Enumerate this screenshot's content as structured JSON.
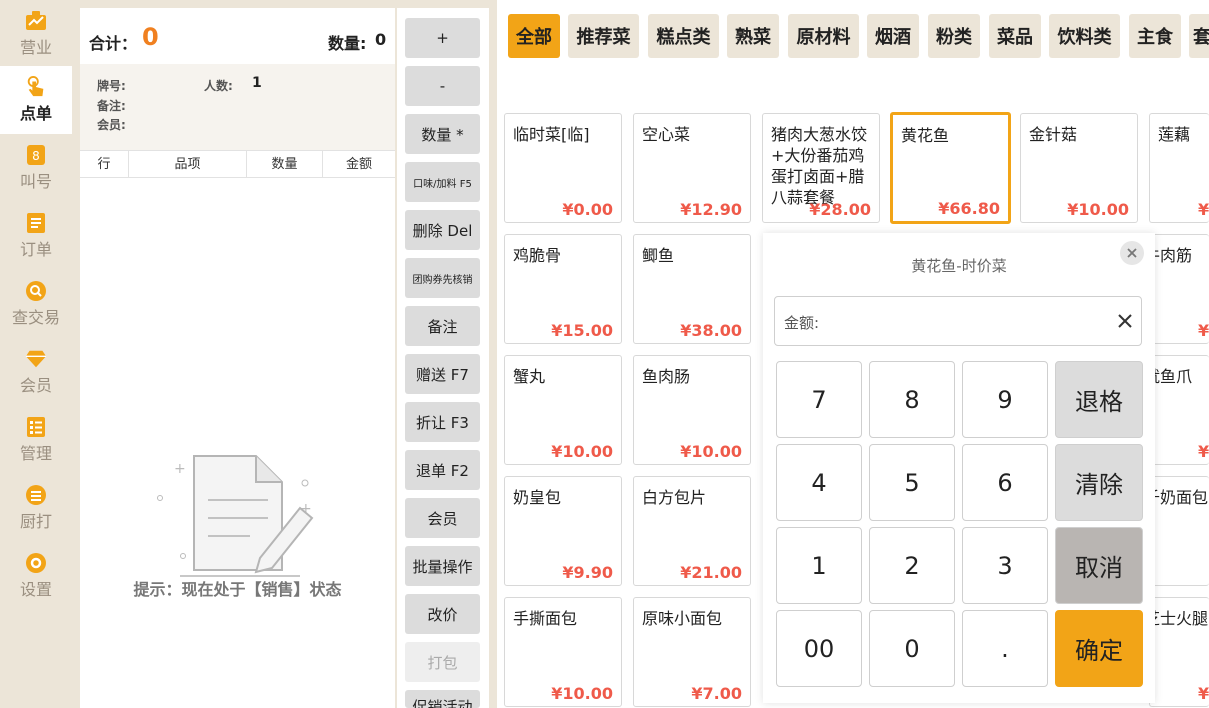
{
  "nav": {
    "items": [
      {
        "label": "营业",
        "icon": "chart-icon"
      },
      {
        "label": "点单",
        "icon": "tap-hand-icon"
      },
      {
        "label": "叫号",
        "icon": "number-icon"
      },
      {
        "label": "订单",
        "icon": "list-icon"
      },
      {
        "label": "查交易",
        "icon": "search-icon"
      },
      {
        "label": "会员",
        "icon": "diamond-icon"
      },
      {
        "label": "管理",
        "icon": "checklist-icon"
      },
      {
        "label": "厨打",
        "icon": "menu-icon"
      },
      {
        "label": "设置",
        "icon": "gear-icon"
      }
    ],
    "active_index": 1
  },
  "order": {
    "total_label": "合计：",
    "total_value": "0",
    "qty_label": "数量:",
    "qty_value": "0",
    "tag_label": "牌号:",
    "people_label": "人数:",
    "people_value": "1",
    "note_label": "备注:",
    "member_label": "会员:",
    "columns": [
      "行",
      "品项",
      "数量",
      "金额"
    ],
    "empty_tip": "提示：现在处于【销售】状态"
  },
  "actions": [
    {
      "label": "+",
      "size": "normal"
    },
    {
      "label": "-",
      "size": "normal"
    },
    {
      "label": "数量 *",
      "size": "normal"
    },
    {
      "label": "口味/加料 F5",
      "size": "small"
    },
    {
      "label": "删除 Del",
      "size": "normal"
    },
    {
      "label": "团购券先核销",
      "size": "small"
    },
    {
      "label": "备注",
      "size": "normal"
    },
    {
      "label": "赠送 F7",
      "size": "normal"
    },
    {
      "label": "折让 F3",
      "size": "normal"
    },
    {
      "label": "退单 F2",
      "size": "normal"
    },
    {
      "label": "会员",
      "size": "normal"
    },
    {
      "label": "批量操作",
      "size": "normal"
    },
    {
      "label": "改价",
      "size": "normal"
    },
    {
      "label": "打包",
      "size": "disabled"
    },
    {
      "label": "促销活动",
      "size": "normal"
    }
  ],
  "categories": [
    "全部",
    "推荐菜",
    "糕点类",
    "熟菜",
    "原材料",
    "烟酒",
    "粉类",
    "菜品",
    "饮料类",
    "主食",
    "套"
  ],
  "active_category": 0,
  "dishes": [
    {
      "name": "临时菜[临]",
      "price": "¥0.00"
    },
    {
      "name": "空心菜",
      "price": "¥12.90"
    },
    {
      "name": "猪肉大葱水饺+大份番茄鸡蛋打卤面+腊八蒜套餐",
      "price": "¥28.00"
    },
    {
      "name": "黄花鱼",
      "price": "¥66.80"
    },
    {
      "name": "金针菇",
      "price": "¥10.00"
    },
    {
      "name": "莲藕",
      "price": "¥"
    },
    {
      "name": "鸡脆骨",
      "price": "¥15.00"
    },
    {
      "name": "鲫鱼",
      "price": "¥38.00"
    },
    {
      "name": "牛肉筋",
      "price": "¥"
    },
    {
      "name": "蟹丸",
      "price": "¥10.00"
    },
    {
      "name": "鱼肉肠",
      "price": "¥10.00"
    },
    {
      "name": "鱿鱼爪",
      "price": "¥"
    },
    {
      "name": "奶皇包",
      "price": "¥9.90"
    },
    {
      "name": "白方包片",
      "price": "¥21.00"
    },
    {
      "name": "千奶面包",
      "price": ""
    },
    {
      "name": "手撕面包",
      "price": "¥10.00"
    },
    {
      "name": "原味小面包",
      "price": "¥7.00"
    },
    {
      "name": "芝士火腿",
      "price": "¥"
    }
  ],
  "selected_dish": 3,
  "dialog": {
    "title": "黄花鱼-时价菜",
    "amount_label": "金额:",
    "amount_value": "",
    "keys": [
      "7",
      "8",
      "9",
      "退格",
      "4",
      "5",
      "6",
      "清除",
      "1",
      "2",
      "3",
      "取消",
      "00",
      "0",
      ".",
      "确定"
    ]
  },
  "colors": {
    "accent": "#f2a417",
    "price": "#ef5a4a",
    "total": "#f08020",
    "nav_bg": "#ece5d8"
  }
}
